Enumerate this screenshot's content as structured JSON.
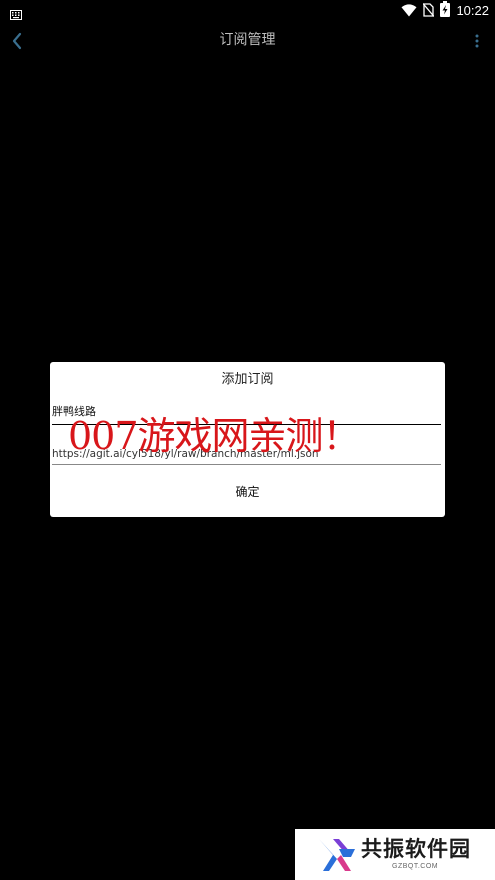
{
  "status_bar": {
    "time": "10:22",
    "icons": [
      "keyboard-icon",
      "wifi-icon",
      "no-sim-icon",
      "battery-charging-icon"
    ]
  },
  "app_bar": {
    "title": "订阅管理",
    "back_icon": "chevron-left-icon",
    "more_icon": "more-vert-icon",
    "accent_color": "#3a6f8f"
  },
  "dialog": {
    "title": "添加订阅",
    "name_value": "胖鸭线路",
    "url_value": "https://agit.ai/cyl518/yl/raw/branch/master/ml.json",
    "confirm_label": "确定"
  },
  "watermark": {
    "text": "007游戏网亲测！",
    "color": "#d8161a"
  },
  "logo": {
    "name": "共振软件园",
    "sub": "GZBQT.COM"
  }
}
